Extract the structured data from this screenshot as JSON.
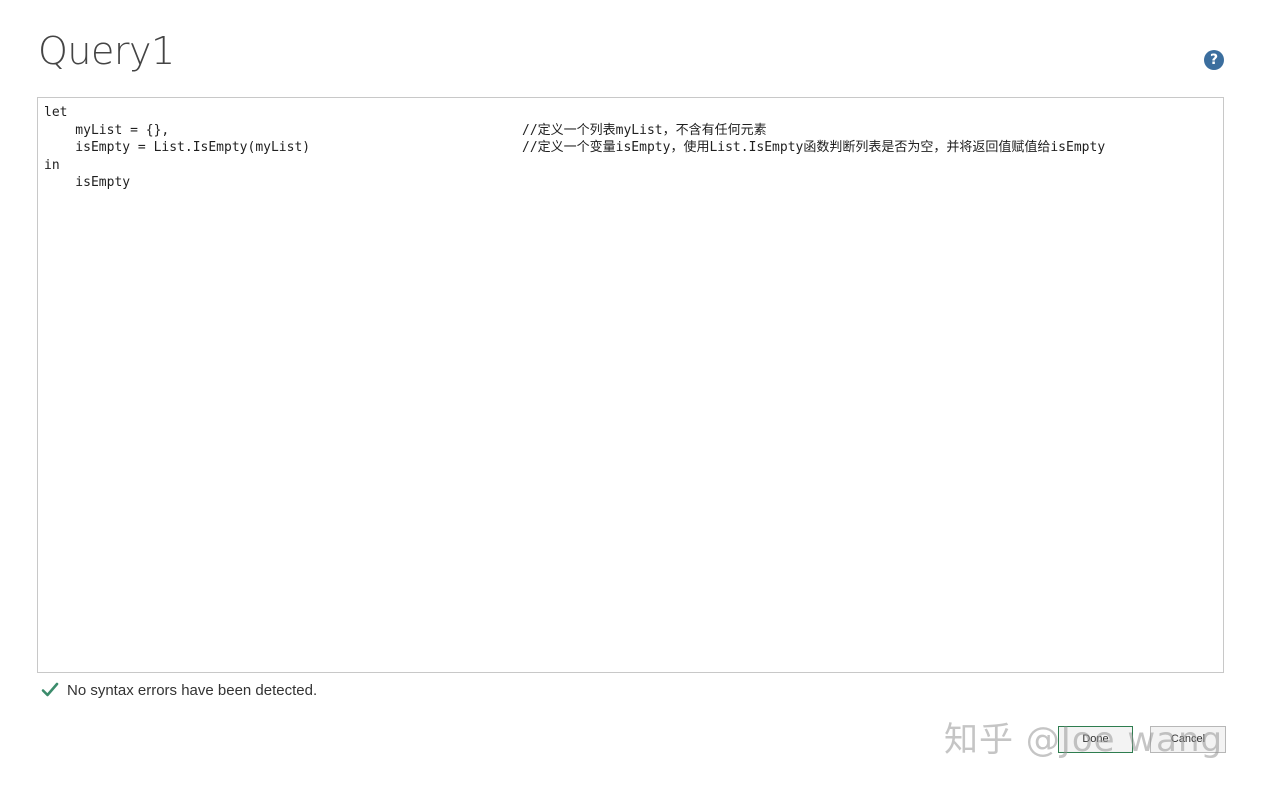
{
  "dialog": {
    "title": "Query1",
    "help_icon": "question-mark-icon",
    "help_symbol": "?"
  },
  "editor": {
    "lines": [
      {
        "code": "let",
        "comment": ""
      },
      {
        "code": "    myList = {},",
        "comment": "//定义一个列表myList，不含有任何元素"
      },
      {
        "code": "    isEmpty = List.IsEmpty(myList)",
        "comment": "//定义一个变量isEmpty，使用List.IsEmpty函数判断列表是否为空，并将返回值赋值给isEmpty"
      },
      {
        "code": "in",
        "comment": ""
      },
      {
        "code": "    isEmpty",
        "comment": ""
      }
    ]
  },
  "status": {
    "icon": "checkmark-icon",
    "text": "No syntax errors have been detected.",
    "color": "#3c8c6c"
  },
  "buttons": {
    "done_label": "Done",
    "cancel_label": "Cancel"
  },
  "watermark": {
    "text": "知乎 @Joe wang"
  },
  "colors": {
    "accent": "#3b6e9e",
    "done_border": "#2e7d4f"
  }
}
